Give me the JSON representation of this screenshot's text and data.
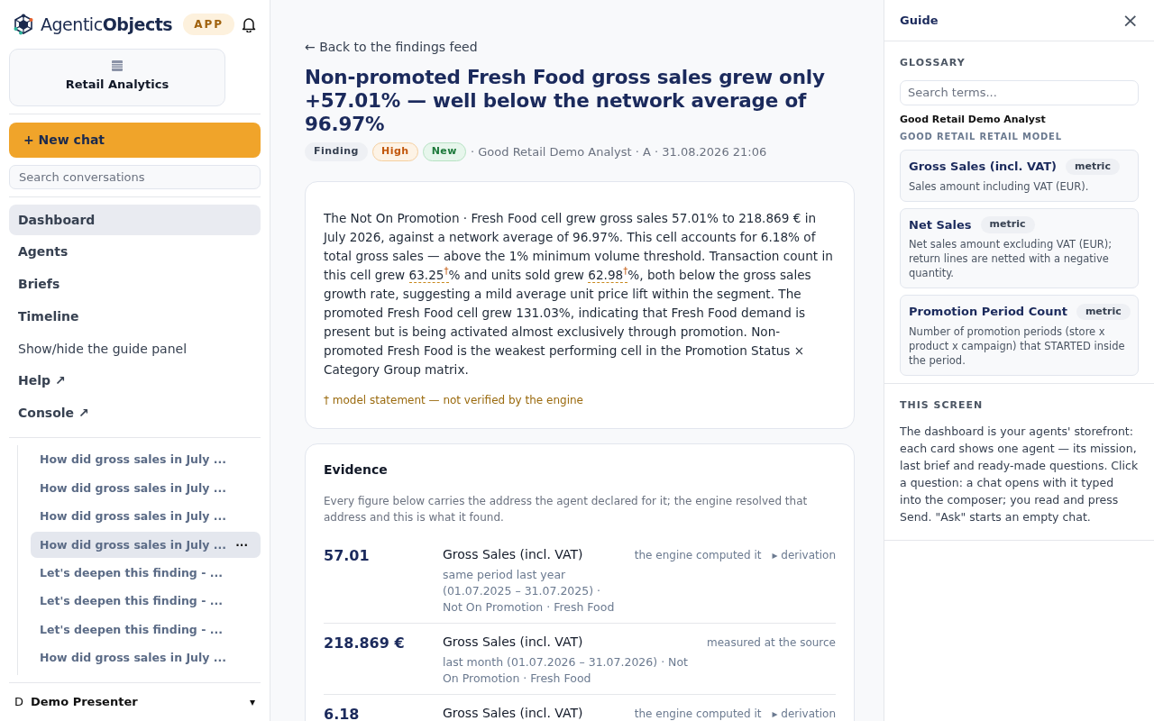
{
  "brand": {
    "name_light": "Agentic",
    "name_bold": "Objects",
    "badge": "APP"
  },
  "workspace": {
    "name": "Retail Analytics"
  },
  "new_chat": "+ New chat",
  "search": {
    "placeholder": "Search conversations"
  },
  "nav": [
    {
      "label": "Dashboard",
      "kind": "link",
      "selected": true
    },
    {
      "label": "Agents",
      "kind": "link",
      "selected": false
    },
    {
      "label": "Briefs",
      "kind": "link",
      "selected": false
    },
    {
      "label": "Timeline",
      "kind": "link",
      "selected": false
    },
    {
      "label": "Show/hide the guide panel",
      "kind": "action",
      "selected": false
    },
    {
      "label": "Help ↗",
      "kind": "link",
      "selected": false
    },
    {
      "label": "Console ↗",
      "kind": "link",
      "selected": false
    }
  ],
  "conversations": [
    {
      "title": "How did gross sales in July ...",
      "selected": false
    },
    {
      "title": "How did gross sales in July ...",
      "selected": false
    },
    {
      "title": "How did gross sales in July ...",
      "selected": false
    },
    {
      "title": "How did gross sales in July ...",
      "selected": true,
      "menu": "···"
    },
    {
      "title": "Let's deepen this finding - ...",
      "selected": false
    },
    {
      "title": "Let's deepen this finding - ...",
      "selected": false
    },
    {
      "title": "Let's deepen this finding - ...",
      "selected": false
    },
    {
      "title": "How did gross sales in July ...",
      "selected": false
    }
  ],
  "user": {
    "initial": "D",
    "name": "Demo Presenter",
    "caret": "▾"
  },
  "back_link": "← Back to the findings feed",
  "title": "Non-promoted Fresh Food gross sales grew only +57.01% — well below the network average of 96.97%",
  "badges": [
    {
      "label": "Finding",
      "kind": "type"
    },
    {
      "label": "High",
      "kind": "severity"
    },
    {
      "label": "New",
      "kind": "status"
    }
  ],
  "meta": "· Good Retail Demo Analyst · A · 31.08.2026 21:06",
  "body": [
    {
      "text": "The Not On Promotion · Fresh Food cell grew gross sales 57.01% to 218.869 € in July 2026, against a network average of 96.97%. This cell accounts for 6.18% of total gross sales — above the 1% minimum volume threshold. Transaction count in this cell grew ",
      "unverified": false
    },
    {
      "text": "63.25$^{†}$",
      "unverified": true
    },
    {
      "text": "% and units sold grew ",
      "unverified": false
    },
    {
      "text": "62.98$^{†}$",
      "unverified": true
    },
    {
      "text": "%, both below the gross sales growth rate, suggesting a mild average unit price lift within the segment. The promoted Fresh Food cell grew 131.03%, indicating that Fresh Food demand is present but is being activated almost exclusively through promotion. Non-promoted Fresh Food is the weakest performing cell in the Promotion Status × Category Group matrix.",
      "unverified": false
    }
  ],
  "footnote": "† model statement — not verified by the engine",
  "evidence": {
    "title": "Evidence",
    "intro": "Every figure below carries the address the agent declared for it; the engine resolved that address and this is what it found.",
    "rows": [
      {
        "value": "57.01",
        "metric": "Gross Sales (incl. VAT)",
        "scope": "same period last year (01.07.2025 – 31.07.2025) · Not On Promotion · Fresh Food",
        "source": "the engine computed it",
        "derivation": "▸ derivation"
      },
      {
        "value": "218.869 €",
        "metric": "Gross Sales (incl. VAT)",
        "scope": "last month (01.07.2026 – 31.07.2026) · Not On Promotion · Fresh Food",
        "source": "measured at the source"
      },
      {
        "value": "6.18",
        "metric": "Gross Sales (incl. VAT)",
        "source": "the engine computed it",
        "derivation": "▸ derivation"
      }
    ]
  },
  "guide": {
    "title": "Guide",
    "close": "×",
    "glossary_heading": "GLOSSARY",
    "search_placeholder": "Search terms...",
    "agent": "Good Retail Demo Analyst",
    "model": "GOOD RETAIL RETAIL MODEL",
    "terms": [
      {
        "name": "Gross Sales (incl. VAT)",
        "tag": "metric",
        "description": "Sales amount including VAT (EUR)."
      },
      {
        "name": "Net Sales",
        "tag": "metric",
        "description": "Net sales amount excluding VAT (EUR); return lines are netted with a negative quantity."
      },
      {
        "name": "Promotion Period Count",
        "tag": "metric",
        "description": "Number of promotion periods (store x product x campaign) that STARTED inside the period."
      }
    ],
    "screen_heading": "THIS SCREEN",
    "screen_text": "The dashboard is your agents' storefront: each card shows one agent — its mission, last brief and ready-made questions. Click a question: a chat opens with it typed into the composer; you read and press Send. \"Ask\" starts an empty chat."
  }
}
